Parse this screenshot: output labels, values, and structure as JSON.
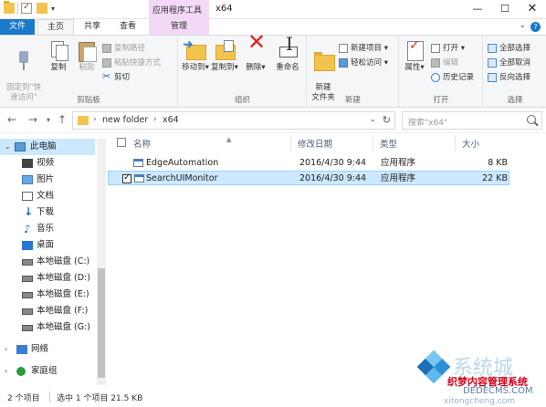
{
  "window": {
    "title": "x64",
    "context_tab_group": "应用程序工具",
    "controls": {
      "minimize": "—",
      "maximize": "☐",
      "close": "✕"
    }
  },
  "tabs": [
    {
      "label": "文件"
    },
    {
      "label": "主页"
    },
    {
      "label": "共享"
    },
    {
      "label": "查看"
    },
    {
      "label": "管理"
    }
  ],
  "ribbon": {
    "clipboard": {
      "label": "剪贴板",
      "pin_quick_access": "固定到\"快\n速访问\"",
      "copy": "复制",
      "paste": "粘贴",
      "copy_path": "复制路径",
      "paste_shortcut": "粘贴快捷方式",
      "cut": "剪切"
    },
    "organize": {
      "label": "组织",
      "move_to": "移动到",
      "copy_to": "复制到",
      "delete": "删除",
      "rename": "重命名"
    },
    "new": {
      "label": "新建",
      "new_folder": "新建\n文件夹",
      "new_item": "新建项目",
      "easy_access": "轻松访问"
    },
    "open": {
      "label": "打开",
      "properties": "属性",
      "open": "打开",
      "edit": "编辑",
      "history": "历史记录"
    },
    "select": {
      "label": "选择",
      "select_all": "全部选择",
      "select_none": "全部取消",
      "invert": "反向选择"
    }
  },
  "address": {
    "segments": [
      "new folder",
      "x64"
    ],
    "search_placeholder": "搜索\"x64\""
  },
  "nav": [
    {
      "label": "此电脑",
      "icon": "pc-icon"
    },
    {
      "label": "视频",
      "icon": "video-icon"
    },
    {
      "label": "图片",
      "icon": "pictures-icon"
    },
    {
      "label": "文档",
      "icon": "documents-icon"
    },
    {
      "label": "下载",
      "icon": "downloads-icon"
    },
    {
      "label": "音乐",
      "icon": "music-icon"
    },
    {
      "label": "桌面",
      "icon": "desktop-icon"
    },
    {
      "label": "本地磁盘 (C:)",
      "icon": "drive-icon"
    },
    {
      "label": "本地磁盘 (D:)",
      "icon": "drive-icon"
    },
    {
      "label": "本地磁盘 (E:)",
      "icon": "drive-icon"
    },
    {
      "label": "本地磁盘 (F:)",
      "icon": "drive-icon"
    },
    {
      "label": "本地磁盘 (G:)",
      "icon": "drive-icon"
    },
    {
      "label": "网络",
      "icon": "network-icon"
    },
    {
      "label": "家庭组",
      "icon": "homegroup-icon"
    }
  ],
  "columns": {
    "name": "名称",
    "modified": "修改日期",
    "type": "类型",
    "size": "大小"
  },
  "files": [
    {
      "name": "EdgeAutomation",
      "modified": "2016/4/30 9:44",
      "type": "应用程序",
      "size": "8 KB"
    },
    {
      "name": "SearchUIMonitor",
      "modified": "2016/4/30 9:44",
      "type": "应用程序",
      "size": "22 KB"
    }
  ],
  "status": {
    "count": "2 个项目",
    "selected": "选中 1 个项目 21.5 KB"
  },
  "watermark": {
    "brand": "系统城",
    "cn": "织梦内容管理系统",
    "en": "DEDECMS.COM",
    "url": "xitongcheng.com"
  },
  "colors": {
    "accent": "#1979ca",
    "selection": "#cce8ff",
    "context_tab": "#f3d9f7"
  }
}
